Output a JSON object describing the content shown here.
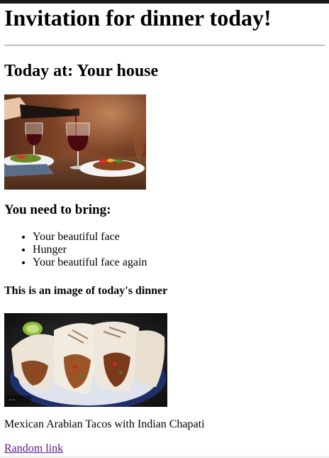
{
  "page": {
    "title": "Invitation for dinner today!",
    "location_heading": "Today at: Your house",
    "bring_heading": "You need to bring:",
    "bring_items": [
      "Your beautiful face",
      "Hunger",
      "Your beautiful face again"
    ],
    "dinner_heading": "This is an image of today's dinner",
    "dinner_caption": "Mexican Arabian Tacos with Indian Chapati",
    "link_text": "Random link"
  },
  "colors": {
    "link_visited": "#551a8b",
    "text": "#000000",
    "background": "#ffffff"
  }
}
